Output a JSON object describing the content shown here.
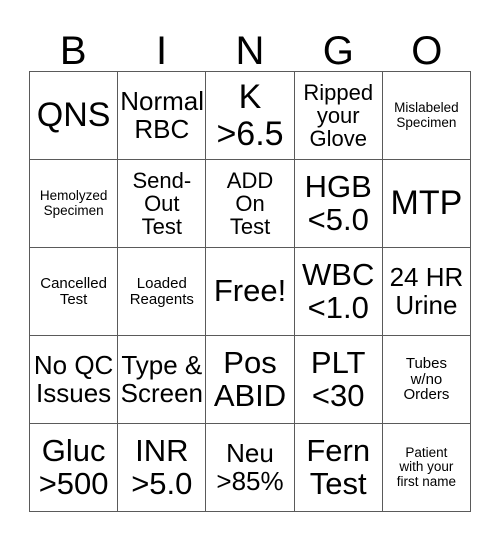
{
  "card": {
    "title": "BINGO",
    "headers": [
      "B",
      "I",
      "N",
      "G",
      "O"
    ],
    "rows": [
      [
        {
          "text": "QNS",
          "size": "fs-xl"
        },
        {
          "text": "Normal\nRBC",
          "size": "fs-md"
        },
        {
          "text": "K\n>6.5",
          "size": "fs-xl"
        },
        {
          "text": "Ripped\nyour\nGlove",
          "size": "fs-sm"
        },
        {
          "text": "Mislabeled\nSpecimen",
          "size": "fs-xxs"
        }
      ],
      [
        {
          "text": "Hemolyzed\nSpecimen",
          "size": "fs-xxs"
        },
        {
          "text": "Send-\nOut\nTest",
          "size": "fs-sm"
        },
        {
          "text": "ADD\nOn\nTest",
          "size": "fs-sm"
        },
        {
          "text": "HGB\n<5.0",
          "size": "fs-lg"
        },
        {
          "text": "MTP",
          "size": "fs-xl"
        }
      ],
      [
        {
          "text": "Cancelled\nTest",
          "size": "fs-xs"
        },
        {
          "text": "Loaded\nReagents",
          "size": "fs-xs"
        },
        {
          "text": "Free!",
          "size": "fs-lg"
        },
        {
          "text": "WBC\n<1.0",
          "size": "fs-lg"
        },
        {
          "text": "24 HR\nUrine",
          "size": "fs-md"
        }
      ],
      [
        {
          "text": "No QC\nIssues",
          "size": "fs-md"
        },
        {
          "text": "Type &\nScreen",
          "size": "fs-md"
        },
        {
          "text": "Pos\nABID",
          "size": "fs-lg"
        },
        {
          "text": "PLT\n<30",
          "size": "fs-lg"
        },
        {
          "text": "Tubes\nw/no\nOrders",
          "size": "fs-xs"
        }
      ],
      [
        {
          "text": "Gluc\n>500",
          "size": "fs-lg"
        },
        {
          "text": "INR\n>5.0",
          "size": "fs-lg"
        },
        {
          "text": "Neu\n>85%",
          "size": "fs-md"
        },
        {
          "text": "Fern\nTest",
          "size": "fs-lg"
        },
        {
          "text": "Patient\nwith your\nfirst name",
          "size": "fs-xxs"
        }
      ]
    ],
    "free_space": "Free!",
    "colors": {
      "background": "#ffffff",
      "text": "#000000",
      "grid_line": "#5a5a5a"
    }
  }
}
